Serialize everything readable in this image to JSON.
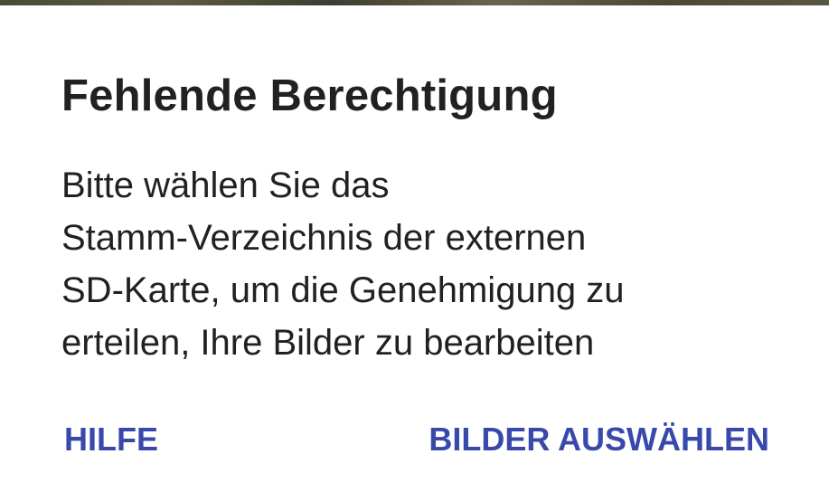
{
  "dialog": {
    "title": "Fehlende Berechtigung",
    "message_lines": [
      "Bitte wählen Sie das",
      "Stamm-Verzeichnis der externen",
      "SD-Karte, um die Genehmigung zu",
      "erteilen, Ihre Bilder zu bearbeiten"
    ],
    "buttons": {
      "help": "HILFE",
      "select_images": "BILDER AUSWÄHLEN"
    },
    "accent_color": "#3949ab"
  }
}
